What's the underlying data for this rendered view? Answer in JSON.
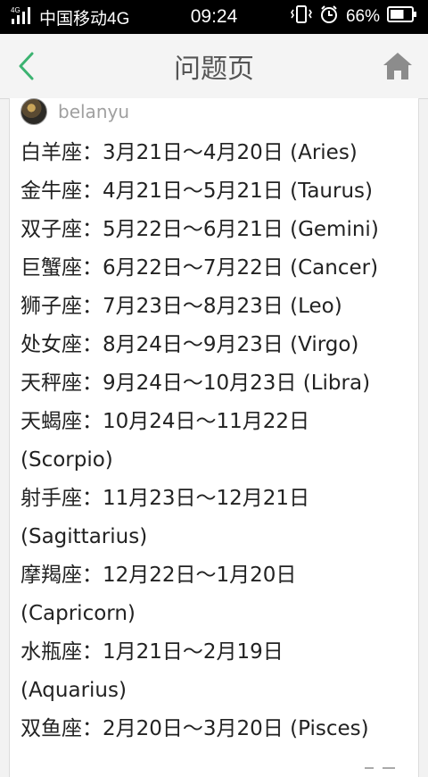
{
  "status_bar": {
    "network_badge": "4G",
    "carrier": "中国移动4G",
    "time": "09:24",
    "battery_percent": "66%",
    "battery_level": 0.66
  },
  "nav": {
    "title": "问题页",
    "accent_color": "#3cb371",
    "home_color": "#8c8c8c"
  },
  "answer": {
    "author": "belanyu",
    "lines": [
      "白羊座：3月21日～4月20日 (Aries)",
      "金牛座：4月21日～5月21日 (Taurus)",
      "双子座：5月22日～6月21日 (Gemini)",
      "巨蟹座：6月22日～7月22日 (Cancer)",
      "狮子座：7月23日～8月23日 (Leo)",
      "处女座：8月24日～9月23日 (Virgo)",
      "天秤座：9月24日～10月23日 (Libra)",
      "天蝎座：10月24日～11月22日",
      "(Scorpio)",
      "射手座：11月23日～12月21日",
      "(Sagittarius)",
      "摩羯座：12月22日～1月20日",
      "(Capricorn)",
      "水瓶座：1月21日～2月19日",
      "(Aquarius)",
      "双鱼座：2月20日～3月20日 (Pisces)"
    ]
  }
}
